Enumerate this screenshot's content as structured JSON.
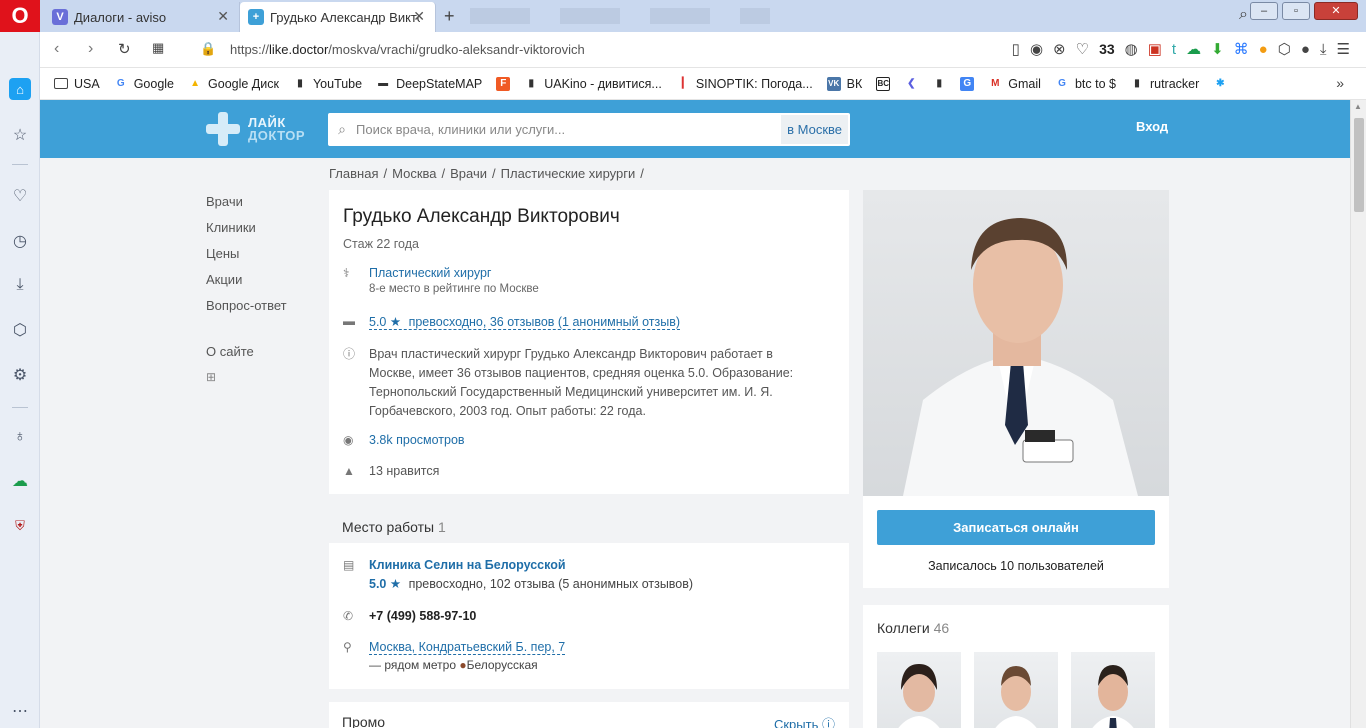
{
  "browser": {
    "tabs": [
      {
        "title": "Диалоги - aviso",
        "active": false
      },
      {
        "title": "Грудько Александр Виктор",
        "active": true
      }
    ],
    "url_prefix": "https://",
    "url_host": "like.doctor",
    "url_path": "/moskva/vrachi/grudko-aleksandr-viktorovich",
    "ext_count": "33",
    "bookmarks": [
      {
        "label": "USA",
        "icon": "folder-icon"
      },
      {
        "label": "Google",
        "icon": "google-icon"
      },
      {
        "label": "Google Диск",
        "icon": "drive-icon"
      },
      {
        "label": "YouTube",
        "icon": "file-icon"
      },
      {
        "label": "DeepStateMAP",
        "icon": "map-icon"
      },
      {
        "label": "",
        "icon": "f-icon"
      },
      {
        "label": "UAKino - дивитися...",
        "icon": "file-icon"
      },
      {
        "label": "SINOPTIK: Погода...",
        "icon": "thermometer-icon"
      },
      {
        "label": "ВК",
        "icon": "vk-icon"
      },
      {
        "label": "",
        "icon": "bc-icon"
      },
      {
        "label": "",
        "icon": "arrow-icon"
      },
      {
        "label": "",
        "icon": "file-icon"
      },
      {
        "label": "",
        "icon": "translate-icon"
      },
      {
        "label": "Gmail",
        "icon": "gmail-icon"
      },
      {
        "label": "btc to $",
        "icon": "google-icon"
      },
      {
        "label": "rutracker",
        "icon": "file-icon"
      },
      {
        "label": "",
        "icon": "star-icon"
      }
    ]
  },
  "site": {
    "logo_line1": "ЛАЙК",
    "logo_line2": "ДОКТОР",
    "search_placeholder": "Поиск врача, клиники или услуги...",
    "search_city": "в Москве",
    "login": "Вход",
    "breadcrumb": [
      "Главная",
      "/",
      "Москва",
      "/",
      "Врачи",
      "/",
      "Пластические хирурги",
      "/"
    ],
    "leftnav": [
      "Врачи",
      "Клиники",
      "Цены",
      "Акции",
      "Вопрос-ответ"
    ],
    "about": "О сайте"
  },
  "doctor": {
    "name": "Грудько Александр Викторович",
    "experience": "Стаж 22 года",
    "specialty": "Пластический хирург",
    "ranking": "8-е место в рейтинге по Москве",
    "rating": "5.0",
    "rating_text": "превосходно, 36 отзывов (1 анонимный отзыв)",
    "description": "Врач пластический хирург Грудько Александр Викторович работает в Москве, имеет 36 отзывов пациентов, средняя оценка 5.0. Образование: Тернопольский Государственный Медицинский университет им. И. Я. Горбачевского, 2003 год. Опыт работы: 22 года.",
    "views": "3.8k просмотров",
    "likes": "13 нравится"
  },
  "workplace": {
    "heading": "Место работы",
    "count": "1",
    "clinic": "Клиника Селин на Белорусской",
    "rating": "5.0",
    "rating_text": "превосходно, 102 отзыва (5 анонимных отзывов)",
    "phone": "+7 (499) 588-97-10",
    "address": "Москва, Кондратьевский Б. пер, 7",
    "metro_prefix": "— рядом метро",
    "metro": "Белорусская",
    "metro_color": "#8b4a2b"
  },
  "booking": {
    "button": "Записаться онлайн",
    "booked": "Записалось 10 пользователей"
  },
  "colleagues": {
    "title": "Коллеги",
    "count": "46"
  },
  "promo": {
    "title": "Промо",
    "hide": "Скрыть"
  },
  "colors": {
    "accent": "#3ea0d7",
    "link": "#1f6ea8",
    "opera": "#e0121b"
  }
}
